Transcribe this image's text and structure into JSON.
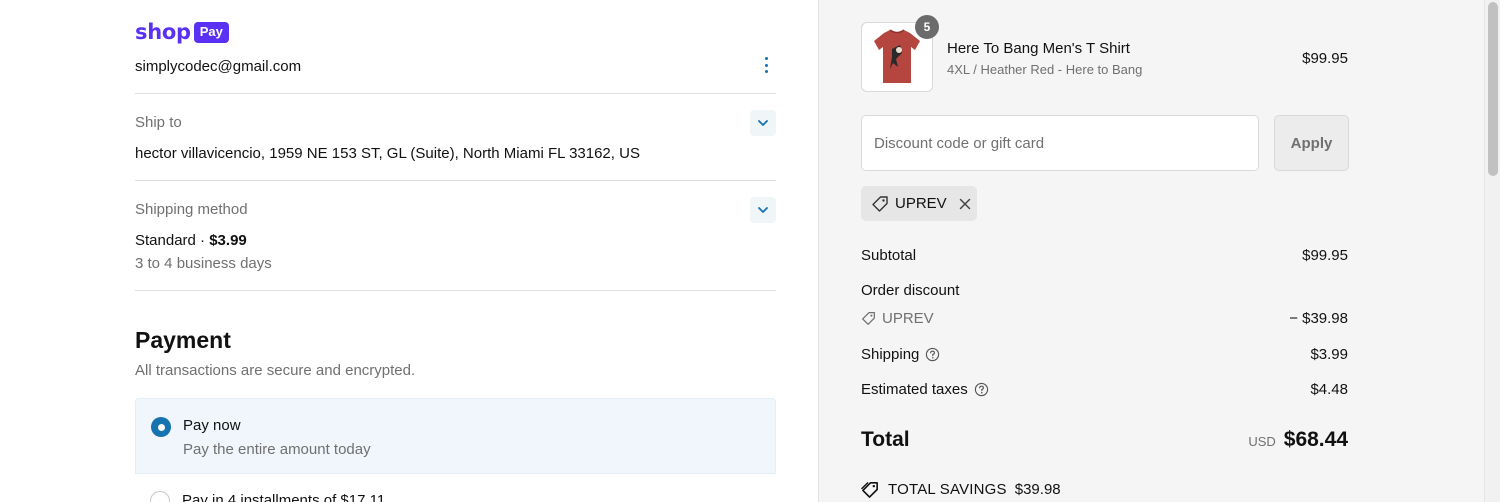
{
  "contact": {
    "brand_word": "shop",
    "brand_badge": "Pay",
    "email": "simplycodec@gmail.com"
  },
  "ship_to": {
    "label": "Ship to",
    "address": "hector villavicencio, 1959 NE 153 ST, GL (Suite), North Miami FL 33162, US"
  },
  "shipping_method": {
    "label": "Shipping method",
    "name": "Standard · ",
    "price": "$3.99",
    "eta": "3 to 4 business days"
  },
  "payment": {
    "title": "Payment",
    "subtitle": "All transactions are secure and encrypted.",
    "options": [
      {
        "title": "Pay now",
        "desc": "Pay the entire amount today",
        "selected": true
      },
      {
        "title": "Pay in 4 installments of $17.11",
        "selected": false
      }
    ]
  },
  "summary": {
    "product": {
      "quantity": "5",
      "name": "Here To Bang Men's T Shirt",
      "variant": "4XL / Heather Red - Here to Bang",
      "price": "$99.95"
    },
    "discount_placeholder": "Discount code or gift card",
    "apply_label": "Apply",
    "applied_code": "UPREV",
    "subtotal_label": "Subtotal",
    "subtotal": "$99.95",
    "order_discount_label": "Order discount",
    "discount_code": "UPREV",
    "discount_amount": "− $39.98",
    "shipping_label": "Shipping",
    "shipping": "$3.99",
    "taxes_label": "Estimated taxes",
    "taxes": "$4.48",
    "total_label": "Total",
    "currency": "USD",
    "total": "$68.44",
    "savings_label": "TOTAL SAVINGS",
    "savings": "$39.98"
  },
  "colors": {
    "accent": "#1773b0",
    "shop_pay": "#5a31f4",
    "product_red": "#b5453f"
  }
}
